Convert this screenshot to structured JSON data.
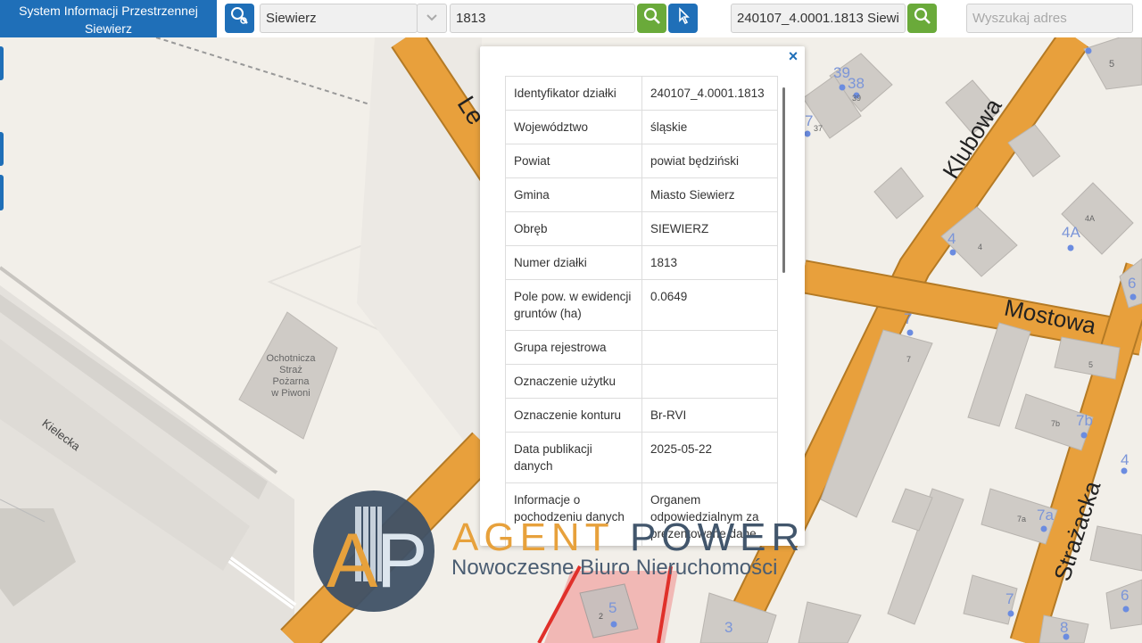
{
  "header": {
    "app_title_line1": "System Informacji Przestrzennej",
    "app_title_line2": "Siewierz",
    "locality_value": "Siewierz",
    "parcel_number_value": "1813",
    "parcel_id_value": "240107_4.0001.1813 Siewi",
    "address_placeholder": "Wyszukaj adres"
  },
  "icons": {
    "locate": "parcel-search-icon",
    "search": "magnifier-icon",
    "identify": "pointer-info-icon",
    "dropdown": "chevron-down-icon",
    "close": "close-icon"
  },
  "colors": {
    "brand_blue": "#1f6fb8",
    "search_green": "#6aaa3a",
    "road_orange": "#e8a03c",
    "parcel_red": "#e0302a"
  },
  "popup": {
    "close_glyph": "×",
    "rows": [
      {
        "label": "Identyfikator działki",
        "value": "240107_4.0001.1813"
      },
      {
        "label": "Województwo",
        "value": "śląskie"
      },
      {
        "label": "Powiat",
        "value": "powiat będziński"
      },
      {
        "label": "Gmina",
        "value": "Miasto Siewierz"
      },
      {
        "label": "Obręb",
        "value": "SIEWIERZ"
      },
      {
        "label": "Numer działki",
        "value": "1813"
      },
      {
        "label": "Pole pow. w ewidencji gruntów (ha)",
        "value": "0.0649"
      },
      {
        "label": "Grupa rejestrowa",
        "value": ""
      },
      {
        "label": "Oznaczenie użytku",
        "value": ""
      },
      {
        "label": "Oznaczenie konturu",
        "value": "Br-RVI"
      },
      {
        "label": "Data publikacji danych",
        "value": "2025-05-22"
      },
      {
        "label": "Informacje o pochodzeniu danych",
        "value": "Organem odpowiedzialnym za prezentowane dane ewidencji gruntów i budynków jest"
      }
    ]
  },
  "map": {
    "streets": [
      "Le",
      "Klubowa",
      "Mostowa",
      "Strażacka",
      "Kielecka"
    ],
    "poi": [
      "Ochotnicza",
      "Straż",
      "Pożarna",
      "w Piwoni"
    ],
    "addresses": [
      "39",
      "38",
      "39",
      "37",
      "7",
      "5",
      "4",
      "4",
      "4A",
      "4A",
      "6",
      "7",
      "7",
      "5",
      "7b",
      "7b",
      "4",
      "7a",
      "7a",
      "7",
      "6",
      "5",
      "2",
      "3",
      "8"
    ]
  },
  "watermark": {
    "monogram_a": "A",
    "monogram_p": "P",
    "brand_a": "AGENT",
    "brand_b": "POWER",
    "tagline": "Nowoczesne Biuro Nieruchomości"
  }
}
